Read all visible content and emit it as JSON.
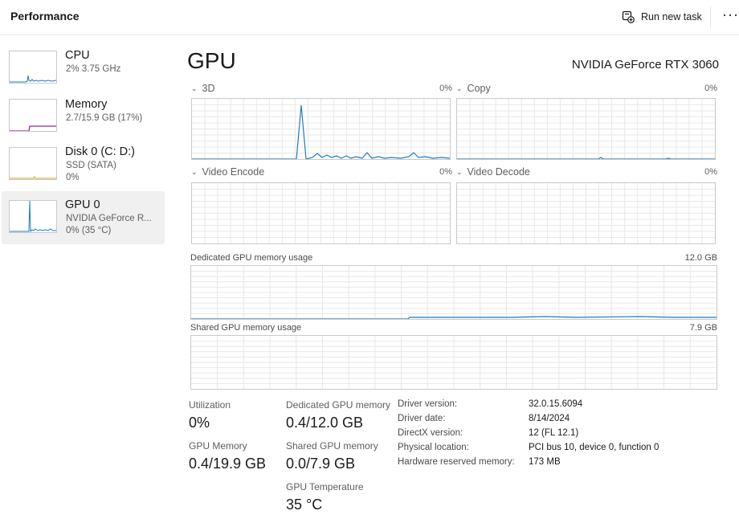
{
  "header": {
    "title": "Performance",
    "run_task_label": "Run new task",
    "more_label": "···"
  },
  "sidebar": {
    "items": [
      {
        "name": "CPU",
        "line1": "2%  3.75 GHz",
        "line2": "",
        "graph_color": "#1e7bc2",
        "active": false
      },
      {
        "name": "Memory",
        "line1": "2.7/15.9 GB (17%)",
        "line2": "",
        "graph_color": "#8e2bb0",
        "active": false
      },
      {
        "name": "Disk 0 (C: D:)",
        "line1": "SSD (SATA)",
        "line2": "0%",
        "graph_color": "#4a9d3b",
        "active": false
      },
      {
        "name": "GPU 0",
        "line1": "NVIDIA GeForce R...",
        "line2": "0%  (35 °C)",
        "graph_color": "#1e7bc2",
        "active": true
      }
    ]
  },
  "main": {
    "title": "GPU",
    "model": "NVIDIA GeForce RTX 3060",
    "engines": [
      {
        "label": "3D",
        "percent": "0%"
      },
      {
        "label": "Copy",
        "percent": "0%"
      },
      {
        "label": "Video Encode",
        "percent": "0%"
      },
      {
        "label": "Video Decode",
        "percent": "0%"
      }
    ],
    "dedicated": {
      "label": "Dedicated GPU memory usage",
      "max": "12.0 GB"
    },
    "shared": {
      "label": "Shared GPU memory usage",
      "max": "7.9 GB"
    },
    "graph_color": "#1e7bc2",
    "grid_color": "#e8e8e8"
  },
  "stats": {
    "utilization": {
      "label": "Utilization",
      "value": "0%"
    },
    "dedicated_mem": {
      "label": "Dedicated GPU memory",
      "value": "0.4/12.0 GB"
    },
    "gpu_memory": {
      "label": "GPU Memory",
      "value": "0.4/19.9 GB"
    },
    "shared_mem": {
      "label": "Shared GPU memory",
      "value": "0.0/7.9 GB"
    },
    "temperature": {
      "label": "GPU Temperature",
      "value": "35 °C"
    }
  },
  "info": [
    {
      "label": "Driver version:",
      "value": "32.0.15.6094"
    },
    {
      "label": "Driver date:",
      "value": "8/14/2024"
    },
    {
      "label": "DirectX version:",
      "value": "12 (FL 12.1)"
    },
    {
      "label": "Physical location:",
      "value": "PCI bus 10, device 0, function 0"
    },
    {
      "label": "Hardware reserved memory:",
      "value": "173 MB"
    }
  ]
}
